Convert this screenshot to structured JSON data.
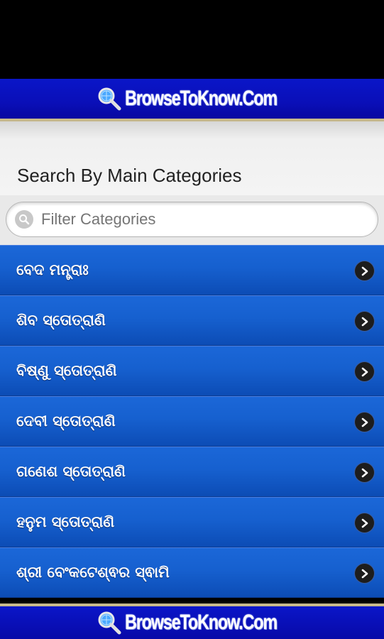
{
  "header": {
    "brand": "BrowseToKnow.Com",
    "icon": "magnifier-globe-icon"
  },
  "page": {
    "title": "Search By Main Categories"
  },
  "search": {
    "placeholder": "Filter Categories",
    "value": ""
  },
  "categories": [
    {
      "label": "ବେଦ ମନ୍ତ୍ରାଃ"
    },
    {
      "label": "ଶିବ ସ୍ତୋତ୍ରାଣି"
    },
    {
      "label": "ବିଷ୍ଣୁ ସ୍ତୋତ୍ରାଣି"
    },
    {
      "label": "ଦେବୀ ସ୍ତୋତ୍ରାଣି"
    },
    {
      "label": "ଗଣେଶ ସ୍ତୋତ୍ରାଣି"
    },
    {
      "label": "ହନୁମ ସ୍ତୋତ୍ରାଣି"
    },
    {
      "label": "ଶ୍ରୀ ବେଂକଟେଶ୍ଵର ସ୍ଵାମି"
    }
  ],
  "footer": {
    "brand": "BrowseToKnow.Com"
  },
  "colors": {
    "header_bg": "#0a12c0",
    "list_bg": "#1660cf",
    "accent_line": "#c7b98a"
  }
}
